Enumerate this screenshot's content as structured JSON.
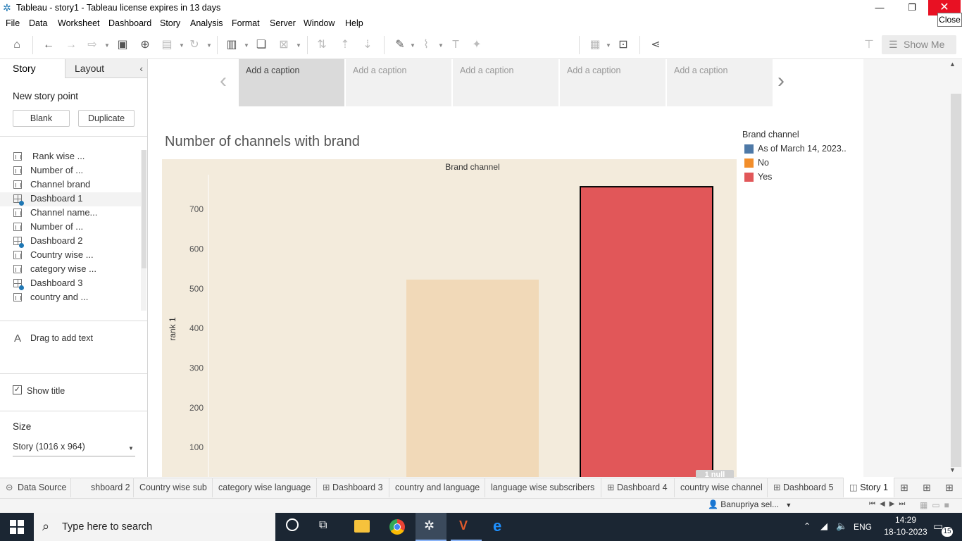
{
  "window": {
    "title": "Tableau - story1 - Tableau license expires in 13 days",
    "close_tooltip": "Close"
  },
  "menu": [
    "File",
    "Data",
    "Worksheet",
    "Dashboard",
    "Story",
    "Analysis",
    "Format",
    "Server",
    "Window",
    "Help"
  ],
  "toolbar": {
    "show_me_label": "Show Me"
  },
  "left_panel": {
    "tab_story": "Story",
    "tab_layout": "Layout",
    "new_story_point": "New story point",
    "blank_button": "Blank",
    "duplicate_button": "Duplicate",
    "sheets": [
      {
        "label": "Rank wise ...",
        "type": "worksheet"
      },
      {
        "label": "Number of ...",
        "type": "worksheet"
      },
      {
        "label": "Channel brand",
        "type": "worksheet"
      },
      {
        "label": "Dashboard 1",
        "type": "dashboard"
      },
      {
        "label": "Channel name...",
        "type": "worksheet"
      },
      {
        "label": "Number of ...",
        "type": "worksheet"
      },
      {
        "label": "Dashboard 2",
        "type": "dashboard"
      },
      {
        "label": "Country wise ...",
        "type": "worksheet"
      },
      {
        "label": "category wise ...",
        "type": "worksheet"
      },
      {
        "label": "Dashboard 3",
        "type": "dashboard"
      },
      {
        "label": "country and ...",
        "type": "worksheet"
      }
    ],
    "drag_text": "Drag to add text",
    "show_title_label": "Show title",
    "show_title_checked": true,
    "size_title": "Size",
    "size_value": "Story (1016 x 964)"
  },
  "story": {
    "captions": [
      "Add a caption",
      "Add a caption",
      "Add a caption",
      "Add a caption",
      "Add a caption"
    ],
    "active_caption_index": 0
  },
  "chart_data": {
    "type": "bar",
    "title": "Number of channels with brand",
    "column_header": "Brand channel",
    "ylabel": "rank 1",
    "y_ticks": [
      100,
      200,
      300,
      400,
      500,
      600,
      700
    ],
    "categories": [
      "As of March 14, 2023..",
      "No",
      "Yes"
    ],
    "values": [
      null,
      523,
      757
    ],
    "colors": [
      "#4e79a7",
      "#f1d9b8",
      "#e15759"
    ],
    "highlighted_index": 2,
    "legend": {
      "title": "Brand channel",
      "items": [
        {
          "label": "As of March 14, 2023..",
          "color": "#4e79a7"
        },
        {
          "label": "No",
          "color": "#f28e2b"
        },
        {
          "label": "Yes",
          "color": "#e15759"
        }
      ]
    },
    "null_indicator": "1 null"
  },
  "sheet_tabs": [
    {
      "label": "Data Source",
      "type": "datasource"
    },
    {
      "label": "shboard 2",
      "type": "worksheet"
    },
    {
      "label": "Country wise sub",
      "type": "worksheet"
    },
    {
      "label": "category wise language",
      "type": "worksheet"
    },
    {
      "label": "Dashboard 3",
      "type": "dashboard"
    },
    {
      "label": "country and language",
      "type": "worksheet"
    },
    {
      "label": "language wise subscribers",
      "type": "worksheet"
    },
    {
      "label": "Dashboard 4",
      "type": "dashboard"
    },
    {
      "label": "country wise channel",
      "type": "worksheet"
    },
    {
      "label": "Dashboard 5",
      "type": "dashboard"
    },
    {
      "label": "Story 1",
      "type": "story"
    }
  ],
  "status": {
    "user": "Banupriya sel..."
  },
  "taskbar": {
    "search_placeholder": "Type here to search",
    "language": "ENG",
    "time": "14:29",
    "date": "18-10-2023",
    "notification_count": "15"
  }
}
